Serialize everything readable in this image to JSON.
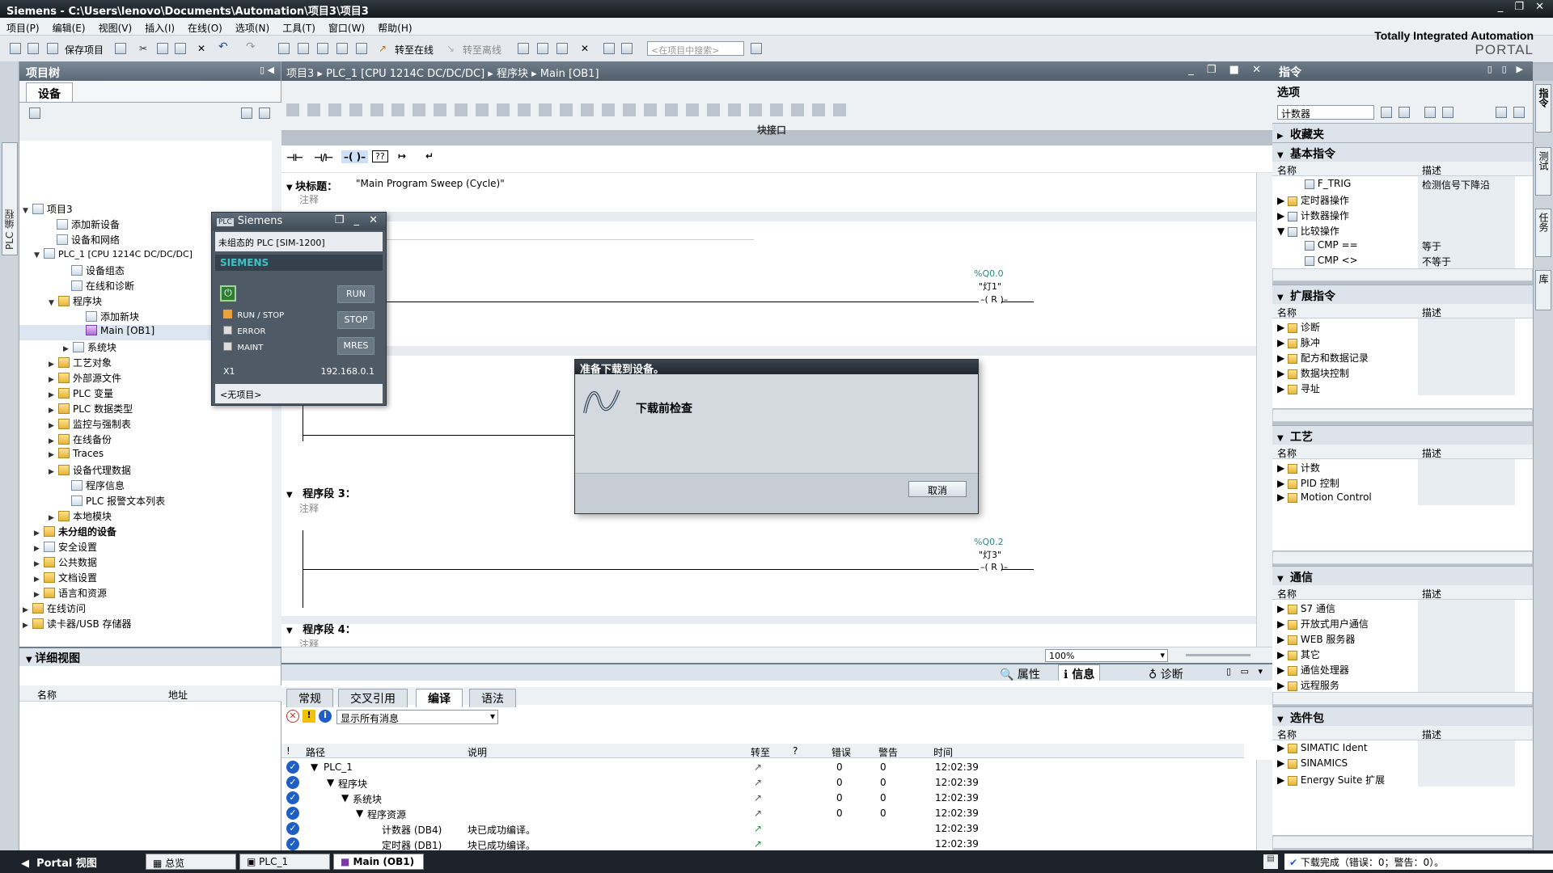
{
  "window": {
    "title": "Siemens  -  C:\\Users\\lenovo\\Documents\\Automation\\项目3\\项目3",
    "controls": "_ ❐ ✕"
  },
  "menu": [
    "项目(P)",
    "编辑(E)",
    "视图(V)",
    "插入(I)",
    "在线(O)",
    "选项(N)",
    "工具(T)",
    "窗口(W)",
    "帮助(H)"
  ],
  "toolbar": {
    "save": "保存项目",
    "go_online": "转至在线",
    "go_offline": "转至离线",
    "search_placeholder": "<在项目中搜索>"
  },
  "brand": {
    "line1": "Totally Integrated Automation",
    "line2": "PORTAL"
  },
  "project_tree": {
    "title": "项目树",
    "tab": "设备",
    "side_label": "PLC 编程",
    "items": [
      {
        "label": "项目3",
        "icon": "project-icon"
      },
      {
        "label": "添加新设备",
        "icon": "add-device-icon"
      },
      {
        "label": "设备和网络",
        "icon": "network-icon"
      },
      {
        "label": "PLC_1 [CPU 1214C DC/DC/DC]",
        "icon": "plc-icon"
      },
      {
        "label": "设备组态",
        "icon": "device-config-icon"
      },
      {
        "label": "在线和诊断",
        "icon": "online-diag-icon"
      },
      {
        "label": "程序块",
        "icon": "folder-icon"
      },
      {
        "label": "添加新块",
        "icon": "add-block-icon"
      },
      {
        "label": "Main [OB1]",
        "icon": "ob-icon"
      },
      {
        "label": "系统块",
        "icon": "folder-icon"
      },
      {
        "label": "工艺对象",
        "icon": "folder-icon"
      },
      {
        "label": "外部源文件",
        "icon": "folder-icon"
      },
      {
        "label": "PLC 变量",
        "icon": "folder-icon"
      },
      {
        "label": "PLC 数据类型",
        "icon": "folder-icon"
      },
      {
        "label": "监控与强制表",
        "icon": "folder-icon"
      },
      {
        "label": "在线备份",
        "icon": "folder-icon"
      },
      {
        "label": "Traces",
        "icon": "folder-icon"
      },
      {
        "label": "设备代理数据",
        "icon": "folder-icon"
      },
      {
        "label": "程序信息",
        "icon": "info-icon"
      },
      {
        "label": "PLC 报警文本列表",
        "icon": "list-icon"
      },
      {
        "label": "本地模块",
        "icon": "folder-icon"
      },
      {
        "label": "未分组的设备",
        "icon": "folder-icon"
      },
      {
        "label": "安全设置",
        "icon": "security-icon"
      },
      {
        "label": "公共数据",
        "icon": "folder-icon"
      },
      {
        "label": "文档设置",
        "icon": "folder-icon"
      },
      {
        "label": "语言和资源",
        "icon": "folder-icon"
      },
      {
        "label": "在线访问",
        "icon": "folder-icon"
      },
      {
        "label": "读卡器/USB 存储器",
        "icon": "folder-icon"
      }
    ]
  },
  "details": {
    "title": "详细视图",
    "col_name": "名称",
    "col_addr": "地址"
  },
  "editor": {
    "breadcrumb": [
      "项目3",
      "PLC_1 [CPU 1214C DC/DC/DC]",
      "程序块",
      "Main [OB1]"
    ],
    "block_interface": "块接口",
    "block_title_label": "块标题：",
    "block_title": "\"Main Program Sweep (Cycle)\"",
    "comment": "注释",
    "networks": [
      {
        "label": "程序段 3："
      },
      {
        "label": "程序段 4："
      }
    ],
    "coils": [
      {
        "addr": "%Q0.0",
        "tag": "\"灯1\"",
        "type": "R"
      },
      {
        "addr": "%Q0.2",
        "tag": "\"灯3\"",
        "type": "R"
      }
    ],
    "zoom": "100%"
  },
  "simulator": {
    "title": "Siemens",
    "subtitle": "未组态的 PLC [SIM-1200]",
    "brand": "SIEMENS",
    "leds": [
      "RUN / STOP",
      "ERROR",
      "MAINT"
    ],
    "buttons": [
      "RUN",
      "STOP",
      "MRES"
    ],
    "port": "X1",
    "ip": "192.168.0.1",
    "project": "<无项目>"
  },
  "dialog": {
    "title": "准备下载到设备。",
    "message": "下载前检查",
    "cancel": "取消"
  },
  "inspector": {
    "tabs": [
      "属性",
      "信息",
      "诊断"
    ],
    "subtabs": [
      "常规",
      "交叉引用",
      "编译",
      "语法"
    ],
    "filter": "显示所有消息",
    "columns": [
      "!",
      "路径",
      "说明",
      "转至",
      "?",
      "错误",
      "警告",
      "时间"
    ],
    "rows": [
      {
        "path": "PLC_1",
        "desc": "",
        "err": "0",
        "warn": "0",
        "time": "12:02:39"
      },
      {
        "path": "程序块",
        "desc": "",
        "err": "0",
        "warn": "0",
        "time": "12:02:39"
      },
      {
        "path": "系统块",
        "desc": "",
        "err": "0",
        "warn": "0",
        "time": "12:02:39"
      },
      {
        "path": "程序资源",
        "desc": "",
        "err": "0",
        "warn": "0",
        "time": "12:02:39"
      },
      {
        "path": "计数器 (DB4)",
        "desc": "块已成功编译。",
        "err": "",
        "warn": "",
        "time": "12:02:39"
      },
      {
        "path": "定时器 (DB1)",
        "desc": "块已成功编译。",
        "err": "",
        "warn": "",
        "time": "12:02:39"
      }
    ]
  },
  "instructions": {
    "title": "指令",
    "options": "选项",
    "search": "计数器",
    "favorites": "收藏夹",
    "basic": "基本指令",
    "extended": "扩展指令",
    "tech": "工艺",
    "comm": "通信",
    "packages": "选件包",
    "col_name": "名称",
    "col_desc": "描述",
    "basic_items": [
      {
        "name": "F_TRIG",
        "desc": "检测信号下降沿"
      },
      {
        "name": "定时器操作",
        "desc": ""
      },
      {
        "name": "计数器操作",
        "desc": ""
      },
      {
        "name": "比较操作",
        "desc": ""
      },
      {
        "name": "CMP ==",
        "desc": "等于"
      },
      {
        "name": "CMP <>",
        "desc": "不等于"
      }
    ],
    "ext_items": [
      "诊断",
      "脉冲",
      "配方和数据记录",
      "数据块控制",
      "寻址"
    ],
    "tech_items": [
      "计数",
      "PID 控制",
      "Motion Control"
    ],
    "comm_items": [
      "S7 通信",
      "开放式用户通信",
      "WEB 服务器",
      "其它",
      "通信处理器",
      "远程服务"
    ],
    "pkg_items": [
      "SIMATIC Ident",
      "SINAMICS",
      "Energy Suite 扩展"
    ],
    "side_tabs": [
      "指令",
      "测试",
      "任务",
      "库"
    ]
  },
  "statusbar": {
    "portal": "Portal 视图",
    "tabs": [
      "总览",
      "PLC_1",
      "Main (OB1)"
    ],
    "message": "下载完成（错误：0；警告：0）。"
  }
}
